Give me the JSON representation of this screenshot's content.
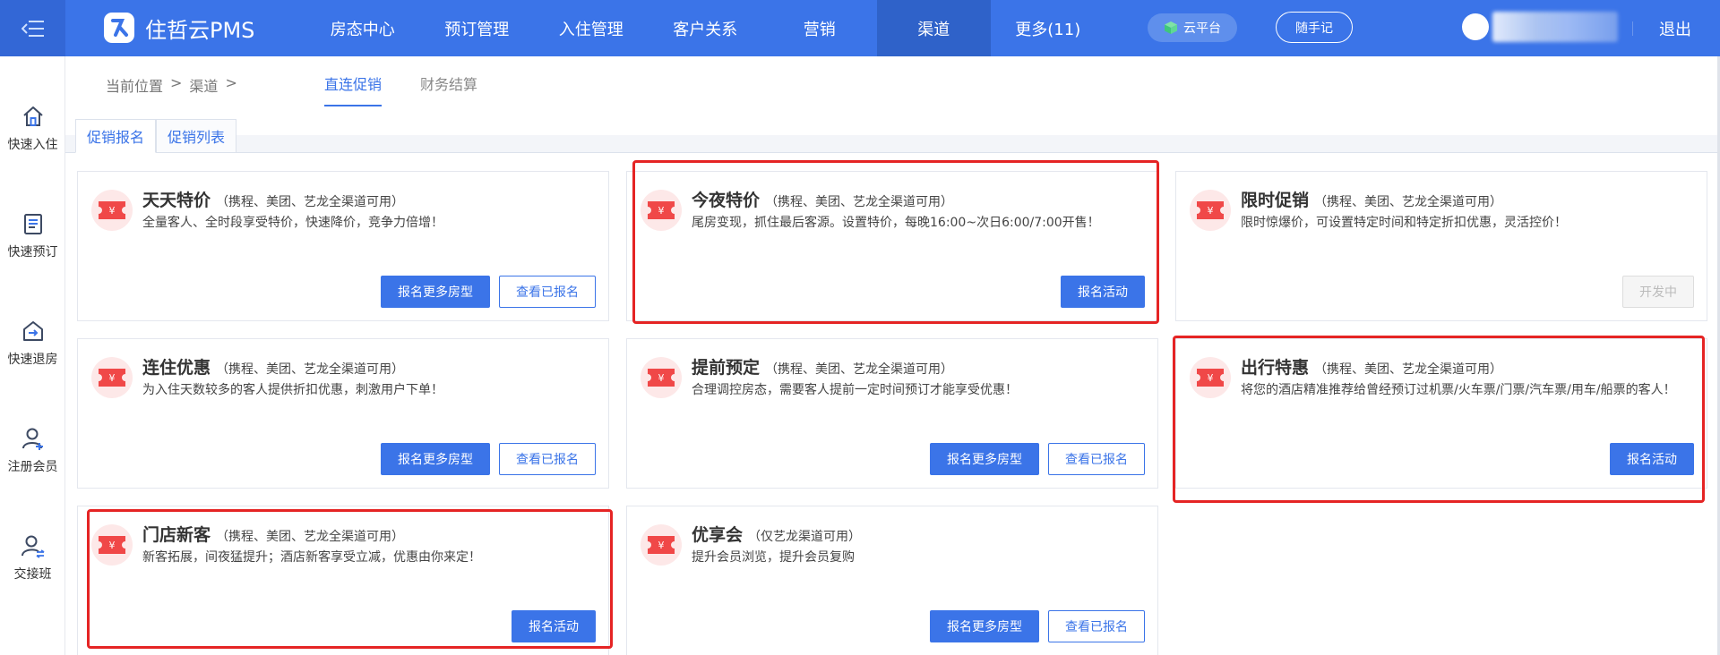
{
  "app": {
    "name": "住哲云PMS"
  },
  "nav": {
    "items": [
      {
        "label": "房态中心"
      },
      {
        "label": "预订管理"
      },
      {
        "label": "入住管理"
      },
      {
        "label": "客户关系"
      },
      {
        "label": "营销"
      },
      {
        "label": "渠道",
        "active": true
      },
      {
        "label": "更多(11)"
      }
    ],
    "cloud_label": "云平台",
    "note_label": "随手记",
    "logout_label": "退出"
  },
  "sidebar": {
    "items": [
      {
        "label": "快速入住",
        "icon": "home-icon"
      },
      {
        "label": "快速预订",
        "icon": "document-icon"
      },
      {
        "label": "快速退房",
        "icon": "checkout-icon"
      },
      {
        "label": "注册会员",
        "icon": "add-user-icon"
      },
      {
        "label": "交接班",
        "icon": "shift-handover-icon"
      }
    ]
  },
  "breadcrumb": {
    "prefix": "当前位置",
    "sep": ">",
    "current": "渠道",
    "trailing_sep": ">"
  },
  "top_tabs": [
    {
      "label": "直连促销",
      "active": true
    },
    {
      "label": "财务结算",
      "active": false
    }
  ],
  "sub_tabs": [
    {
      "label": "促销报名",
      "active": true
    },
    {
      "label": "促销列表",
      "active": false
    }
  ],
  "cards": [
    {
      "title": "天天特价",
      "scope": "（携程、美团、艺龙全渠道可用）",
      "desc": "全量客人、全时段享受特价，快速降价，竞争力倍增！",
      "actions": [
        {
          "label": "报名更多房型",
          "style": "primary"
        },
        {
          "label": "查看已报名",
          "style": "outline"
        }
      ],
      "highlighted": false
    },
    {
      "title": "今夜特价",
      "scope": "（携程、美团、艺龙全渠道可用）",
      "desc": "尾房变现，抓住最后客源。设置特价，每晚16:00~次日6:00/7:00开售！",
      "actions": [
        {
          "label": "报名活动",
          "style": "primary"
        }
      ],
      "highlighted": true
    },
    {
      "title": "限时促销",
      "scope": "（携程、美团、艺龙全渠道可用）",
      "desc": "限时惊爆价，可设置特定时间和特定折扣优惠，灵活控价！",
      "actions": [
        {
          "label": "开发中",
          "style": "disabled"
        }
      ],
      "highlighted": false
    },
    {
      "title": "连住优惠",
      "scope": "（携程、美团、艺龙全渠道可用）",
      "desc": "为入住天数较多的客人提供折扣优惠，刺激用户下单！",
      "actions": [
        {
          "label": "报名更多房型",
          "style": "primary"
        },
        {
          "label": "查看已报名",
          "style": "outline"
        }
      ],
      "highlighted": false
    },
    {
      "title": "提前预定",
      "scope": "（携程、美团、艺龙全渠道可用）",
      "desc": "合理调控房态，需要客人提前一定时间预订才能享受优惠！",
      "actions": [
        {
          "label": "报名更多房型",
          "style": "primary"
        },
        {
          "label": "查看已报名",
          "style": "outline"
        }
      ],
      "highlighted": false
    },
    {
      "title": "出行特惠",
      "scope": "（携程、美团、艺龙全渠道可用）",
      "desc": "将您的酒店精准推荐给曾经预订过机票/火车票/门票/汽车票/用车/船票的客人！",
      "actions": [
        {
          "label": "报名活动",
          "style": "primary"
        }
      ],
      "highlighted": true
    },
    {
      "title": "门店新客",
      "scope": "（携程、美团、艺龙全渠道可用）",
      "desc": "新客拓展，间夜猛提升；酒店新客享受立减，优惠由你来定！",
      "actions": [
        {
          "label": "报名活动",
          "style": "primary"
        }
      ],
      "highlighted": true
    },
    {
      "title": "优享会",
      "scope": "（仅艺龙渠道可用）",
      "desc": "提升会员浏览，提升会员复购",
      "actions": [
        {
          "label": "报名更多房型",
          "style": "primary"
        },
        {
          "label": "查看已报名",
          "style": "outline"
        }
      ],
      "highlighted": false
    }
  ],
  "colors": {
    "brand": "#3b74e8",
    "highlight": "#e52424",
    "icon_bg": "#fde8e8",
    "icon_fg": "#f04848"
  }
}
